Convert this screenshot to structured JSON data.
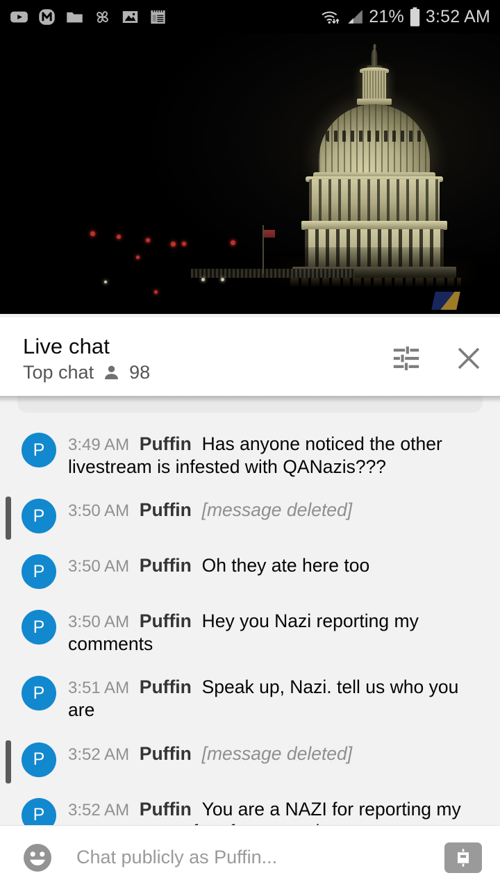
{
  "status_bar": {
    "time": "3:52 AM",
    "battery_percent": "21%",
    "left_icons": [
      "youtube-icon",
      "m-app-icon",
      "folder-icon",
      "pinwheel-icon",
      "gallery-icon",
      "notepad-icon"
    ],
    "right_icons": [
      "wifi-icon",
      "cellular-signal-icon",
      "battery-icon"
    ]
  },
  "video": {
    "description": "US Capitol dome illuminated at night livestream",
    "progress_color": "#ea0b0b"
  },
  "chat_header": {
    "title": "Live chat",
    "mode": "Top chat",
    "viewer_count": "98",
    "settings_label": "Live chat settings",
    "close_label": "Close live chat"
  },
  "messages": [
    {
      "time": "3:49 AM",
      "author": "Puffin",
      "text": "Has anyone noticed the other livestream is infested with QANazis???",
      "deleted": false,
      "avatar_initial": "P"
    },
    {
      "time": "3:50 AM",
      "author": "Puffin",
      "text": "[message deleted]",
      "deleted": true,
      "avatar_initial": "P"
    },
    {
      "time": "3:50 AM",
      "author": "Puffin",
      "text": "Oh they ate here too",
      "deleted": false,
      "avatar_initial": "P"
    },
    {
      "time": "3:50 AM",
      "author": "Puffin",
      "text": "Hey you Nazi reporting my comments",
      "deleted": false,
      "avatar_initial": "P"
    },
    {
      "time": "3:51 AM",
      "author": "Puffin",
      "text": "Speak up, Nazi. tell us who you are",
      "deleted": false,
      "avatar_initial": "P"
    },
    {
      "time": "3:52 AM",
      "author": "Puffin",
      "text": "[message deleted]",
      "deleted": true,
      "avatar_initial": "P"
    },
    {
      "time": "3:52 AM",
      "author": "Puffin",
      "text": "You are a NAZI for reporting my comments you fear free speech",
      "deleted": false,
      "avatar_initial": "P"
    }
  ],
  "input_bar": {
    "placeholder": "Chat publicly as Puffin...",
    "emoji_label": "Emoji picker",
    "superchat_label": "Send Super Chat"
  },
  "colors": {
    "avatar_blue": "#1288ce",
    "progress_red": "#ea0b0b",
    "chat_bg": "#f2f2f2",
    "header_bg": "#ffffff"
  }
}
